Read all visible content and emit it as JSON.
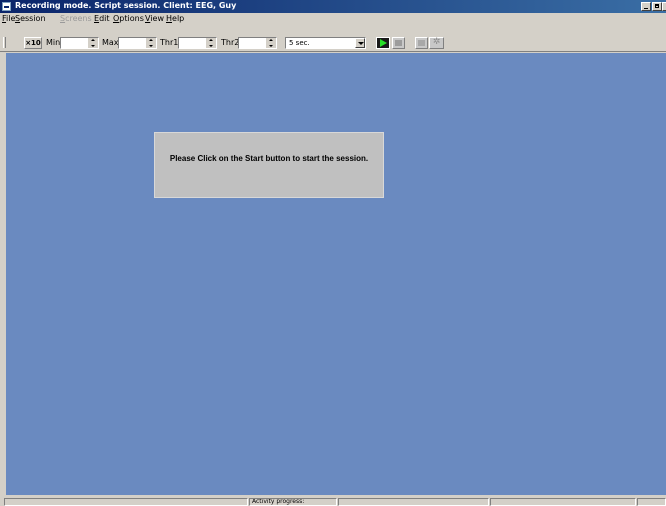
{
  "window": {
    "title": "Recording mode. Script session. Client: EEG, Guy",
    "icons": [
      "app-icon",
      "minimize-icon",
      "maximize-icon",
      "close-icon"
    ]
  },
  "menubar": {
    "items": [
      {
        "label": "File",
        "disabled": false
      },
      {
        "label": "Session",
        "disabled": false
      },
      {
        "label": "Screens",
        "disabled": true
      },
      {
        "label": "Edit",
        "disabled": false
      },
      {
        "label": "Options",
        "disabled": false
      },
      {
        "label": "View",
        "disabled": false
      },
      {
        "label": "Help",
        "disabled": false
      }
    ]
  },
  "toolbar": {
    "scale_button_label": "×10",
    "min_label": "Min",
    "min_value": "",
    "max_label": "Max",
    "max_value": "",
    "thr1_label": "Thr1",
    "thr1_value": "",
    "thr2_label": "Thr2",
    "thr2_value": "",
    "time_window_value": "5 sec.",
    "gear_glyph": "✲",
    "icons": [
      "play-icon",
      "stop-icon",
      "pause-icon",
      "gear-icon"
    ]
  },
  "main": {
    "message": "Please Click on the Start button to start the session."
  },
  "statusbar": {
    "activity_label": "Activity progress:"
  },
  "colors": {
    "titlebar_start": "#0a246a",
    "workspace": "#6a8ac0",
    "message_box": "#c0c0c0",
    "play_green": "#28e028"
  }
}
